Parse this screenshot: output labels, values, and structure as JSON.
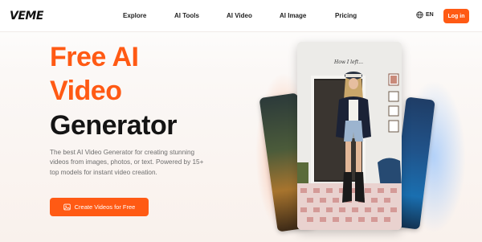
{
  "header": {
    "logo": "VEME",
    "nav": [
      "Explore",
      "AI Tools",
      "AI Video",
      "AI Image",
      "Pricing"
    ],
    "language": "EN",
    "login_label": "Log in"
  },
  "hero": {
    "title_lines": [
      "Free AI",
      "Video",
      "Generator"
    ],
    "description": "The best AI Video Generator for creating stunning videos from images, photos, or text. Powered by 15+ top models for instant video creation.",
    "cta_label": "Create Videos for Free"
  },
  "media": {
    "overlay_caption": "How I left..."
  },
  "colors": {
    "accent": "#ff5a14",
    "title_dark": "#141414"
  },
  "icons": {
    "language": "globe-icon",
    "cta": "image-icon"
  }
}
